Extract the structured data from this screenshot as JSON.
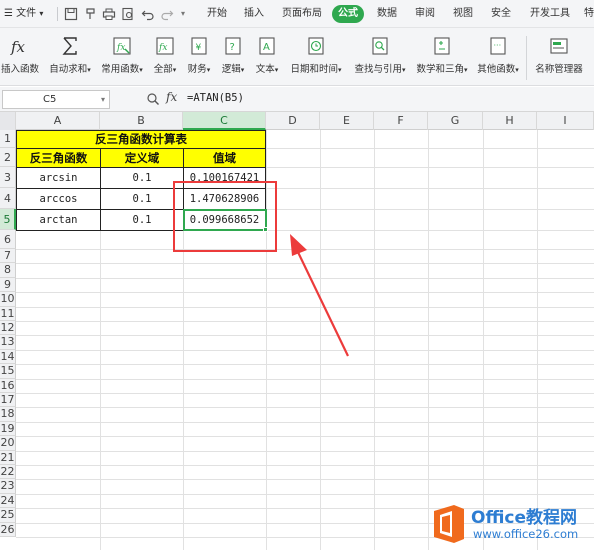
{
  "menubar": {
    "file_label": "文件",
    "tabs": [
      "开始",
      "插入",
      "页面布局",
      "公式",
      "数据",
      "审阅",
      "视图",
      "安全",
      "开发工具",
      "特"
    ],
    "active_tab": "公式",
    "quick_icons": [
      "save-icon",
      "format-painter-icon",
      "print-icon",
      "print-preview-icon",
      "undo-icon",
      "redo-icon",
      "dropdown-icon"
    ]
  },
  "ribbon": {
    "buttons": [
      {
        "label": "插入函数",
        "icon": "fx-icon"
      },
      {
        "label": "自动求和",
        "icon": "sigma-icon"
      },
      {
        "label": "常用函数",
        "icon": "common-functions-icon"
      },
      {
        "label": "全部",
        "icon": "all-functions-icon"
      },
      {
        "label": "财务",
        "icon": "finance-icon"
      },
      {
        "label": "逻辑",
        "icon": "logic-icon"
      },
      {
        "label": "文本",
        "icon": "text-icon"
      },
      {
        "label": "日期和时间",
        "icon": "clock-icon"
      },
      {
        "label": "查找与引用",
        "icon": "lookup-icon"
      },
      {
        "label": "数学和三角",
        "icon": "math-icon"
      },
      {
        "label": "其他函数",
        "icon": "more-functions-icon"
      },
      {
        "label": "名称管理器",
        "icon": "name-manager-icon"
      }
    ]
  },
  "formula_bar": {
    "name_box": "C5",
    "fx_label": "fx",
    "formula": "=ATAN(B5)"
  },
  "grid": {
    "columns": [
      "A",
      "B",
      "C",
      "D",
      "E",
      "F",
      "G",
      "H",
      "I"
    ],
    "selected_column": "C",
    "rows": [
      "1",
      "2",
      "3",
      "4",
      "5",
      "6",
      "7",
      "8",
      "9",
      "10",
      "11",
      "12",
      "13",
      "14",
      "15",
      "16",
      "17",
      "18",
      "19",
      "20",
      "21",
      "22",
      "23",
      "24",
      "25",
      "26"
    ],
    "selected_row": "5",
    "title": "反三角函数计算表",
    "headers": [
      "反三角函数",
      "定义域",
      "值域"
    ],
    "data_rows": [
      {
        "func": "arcsin",
        "domain": "0.1",
        "value": "0.100167421"
      },
      {
        "func": "arccos",
        "domain": "0.1",
        "value": "1.470628906"
      },
      {
        "func": "arctan",
        "domain": "0.1",
        "value": "0.099668652"
      }
    ]
  },
  "watermark": {
    "brand": "Office教程网",
    "site": "www.office26.com"
  },
  "colors": {
    "accent": "#2fa84f",
    "header_fill": "#ffff00",
    "annotation": "#ec3b3b",
    "watermark": "#2d7dd2"
  }
}
